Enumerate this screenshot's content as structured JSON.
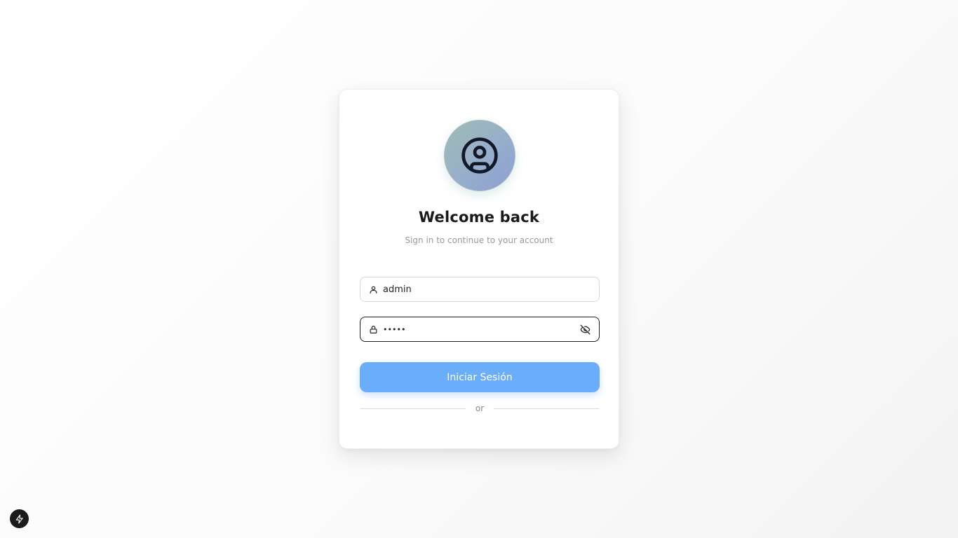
{
  "login": {
    "title": "Welcome back",
    "subtitle": "Sign in to continue to your account",
    "username": {
      "value": "admin",
      "icon": "user-icon"
    },
    "password": {
      "value": "•••••",
      "icon": "lock-icon",
      "toggle_icon": "eye-off-icon"
    },
    "submit_label": "Iniciar Sesión",
    "divider_text": "or",
    "avatar_icon": "user-circle-icon"
  },
  "devtools": {
    "icon": "bolt-icon"
  },
  "colors": {
    "accent": "#6aaefb",
    "card": "#ffffff",
    "text": "#1a1a1a",
    "muted": "#9a9a9a"
  }
}
